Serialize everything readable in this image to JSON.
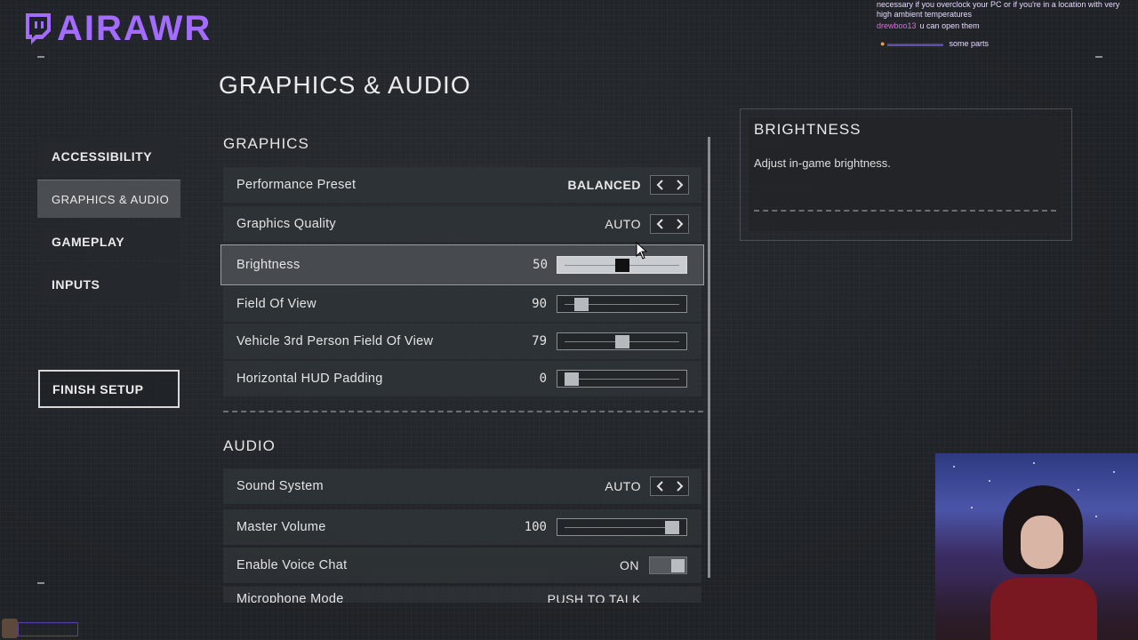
{
  "overlay": {
    "brand_name": "AIRAWR",
    "chat": [
      {
        "user": "",
        "text": "necessary if you overclock your PC or if you're in a location with very"
      },
      {
        "user": "",
        "text": "high ambient temperatures"
      },
      {
        "user": "drewboo13",
        "text": "u can open them"
      },
      {
        "user": "",
        "text": "some parts"
      }
    ]
  },
  "page": {
    "title": "GRAPHICS & AUDIO"
  },
  "nav": {
    "items": [
      {
        "label": "ACCESSIBILITY"
      },
      {
        "label": "GRAPHICS & AUDIO"
      },
      {
        "label": "GAMEPLAY"
      },
      {
        "label": "INPUTS"
      }
    ],
    "finish_label": "FINISH SETUP"
  },
  "graphics": {
    "header": "GRAPHICS",
    "rows": [
      {
        "label": "Performance Preset",
        "value": "BALANCED"
      },
      {
        "label": "Graphics Quality",
        "value": "AUTO"
      },
      {
        "label": "Brightness",
        "value": "50",
        "level": 0.5
      },
      {
        "label": "Field Of View",
        "value": "90",
        "level": 0.1
      },
      {
        "label": "Vehicle 3rd Person Field Of View",
        "value": "79",
        "level": 0.5
      },
      {
        "label": "Horizontal HUD Padding",
        "value": "0",
        "level": 0.0
      }
    ]
  },
  "audio": {
    "header": "AUDIO",
    "rows": [
      {
        "label": "Sound System",
        "value": "AUTO"
      },
      {
        "label": "Master Volume",
        "value": "100",
        "level": 1.0
      },
      {
        "label": "Enable Voice Chat",
        "value": "ON"
      },
      {
        "label": "Microphone Mode",
        "value": "PUSH TO TALK"
      }
    ]
  },
  "info": {
    "title": "BRIGHTNESS",
    "description": "Adjust in-game brightness."
  },
  "colors": {
    "brand": "#a36bff",
    "panel": "#303438",
    "selected": "#474b50"
  },
  "icons": {
    "prev": "chevron-left-icon",
    "next": "chevron-right-icon",
    "brand": "twitch-icon"
  }
}
